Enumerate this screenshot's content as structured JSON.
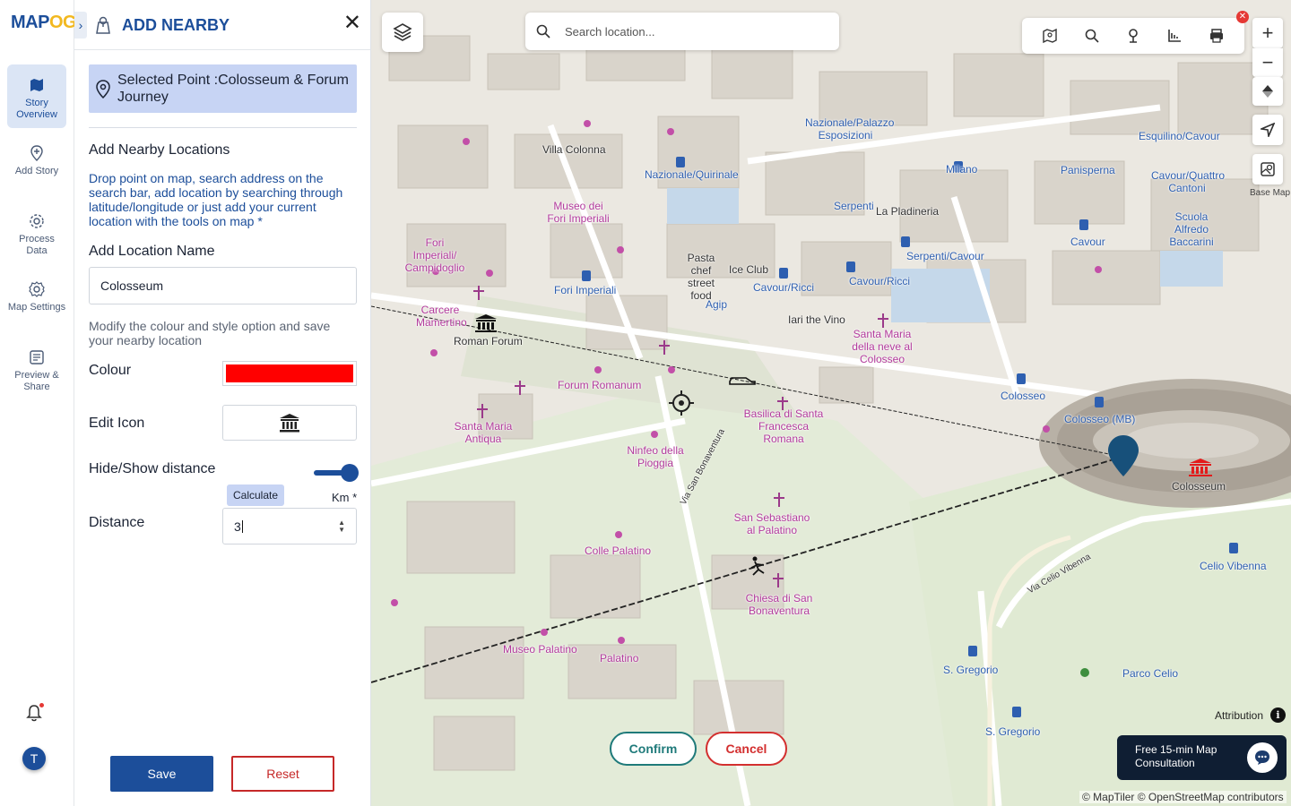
{
  "logo": {
    "text_a": "MAP",
    "text_b": "OG"
  },
  "rail": {
    "items": [
      {
        "label": "Story Overview",
        "icon": "map-icon"
      },
      {
        "label": "Add Story",
        "icon": "pin-plus-icon"
      },
      {
        "label": "Process Data",
        "icon": "gear-icon"
      },
      {
        "label": "Map Settings",
        "icon": "settings-icon"
      },
      {
        "label": "Preview & Share",
        "icon": "preview-icon"
      }
    ],
    "avatar": "T"
  },
  "panel": {
    "title": "ADD NEARBY",
    "selected_point": "Selected Point :Colosseum & Forum Journey",
    "section_title": "Add Nearby Locations",
    "help_text": "Drop point on map, search address on the search bar, add location by searching through latitude/longitude or just add your current location with the tools on map *",
    "location_name_label": "Add Location Name",
    "location_name_value": "Colosseum",
    "modify_text": "Modify the colour and style option and save your nearby location",
    "colour_label": "Colour",
    "colour_value": "#ff0000",
    "edit_icon_label": "Edit Icon",
    "hide_show_label": "Hide/Show distance",
    "calculate_label": "Calculate",
    "unit_label": "Km *",
    "distance_label": "Distance",
    "distance_value": "3",
    "save_label": "Save",
    "reset_label": "Reset"
  },
  "map": {
    "search_placeholder": "Search location...",
    "base_map_label": "Base Map",
    "confirm_label": "Confirm",
    "cancel_label": "Cancel",
    "attribution_label": "Attribution",
    "consult_text": "Free 15-min Map Consultation",
    "copyright": "© MapTiler © OpenStreetMap contributors",
    "labels": [
      {
        "text": "Roman Forum",
        "color": "dark"
      },
      {
        "text": "Forum Romanum",
        "color": "pink"
      },
      {
        "text": "Colosseum",
        "color": "dark"
      },
      {
        "text": "Colosseo",
        "color": "blue"
      },
      {
        "text": "Colosseo (MB)",
        "color": "blue"
      },
      {
        "text": "Basilica di Santa Francesca Romana",
        "color": "pink"
      },
      {
        "text": "Ninfeo della Pioggia",
        "color": "pink"
      },
      {
        "text": "Santa Maria Antiqua",
        "color": "pink"
      },
      {
        "text": "San Sebastiano al Palatino",
        "color": "pink"
      },
      {
        "text": "Colle Palatino",
        "color": "pink"
      },
      {
        "text": "Chiesa di San Bonaventura",
        "color": "pink"
      },
      {
        "text": "Palatino",
        "color": "pink"
      },
      {
        "text": "Museo Palatino",
        "color": "pink"
      },
      {
        "text": "Celio Vibenna",
        "color": "blue"
      },
      {
        "text": "Parco Celio",
        "color": "blue"
      },
      {
        "text": "S. Gregorio",
        "color": "blue"
      },
      {
        "text": "Fori Imperiali/ Campidoglio",
        "color": "pink"
      },
      {
        "text": "Fori Imperiali",
        "color": "blue"
      },
      {
        "text": "Cavour/Ricci",
        "color": "blue"
      },
      {
        "text": "Agip",
        "color": "blue"
      },
      {
        "text": "Ice Club",
        "color": "dark"
      },
      {
        "text": "Pasta chef street food",
        "color": "dark"
      },
      {
        "text": "Iari the Vino",
        "color": "dark"
      },
      {
        "text": "Santa Maria della neve al Colosseo",
        "color": "pink"
      },
      {
        "text": "Serpenti/Cavour",
        "color": "blue"
      },
      {
        "text": "Cavour",
        "color": "blue"
      },
      {
        "text": "Milano",
        "color": "blue"
      },
      {
        "text": "La Pladineria",
        "color": "dark"
      },
      {
        "text": "Serpenti",
        "color": "blue"
      },
      {
        "text": "Nazionale/Quirinale",
        "color": "blue"
      },
      {
        "text": "Villa Colonna",
        "color": "dark"
      },
      {
        "text": "Museo dei Fori Imperiali",
        "color": "pink"
      },
      {
        "text": "Carcere Mamertino",
        "color": "pink"
      },
      {
        "text": "Panisperna",
        "color": "blue"
      },
      {
        "text": "Scuola Alfredo Baccarini",
        "color": "blue"
      },
      {
        "text": "Esquilino/Cavour",
        "color": "blue"
      },
      {
        "text": "Cavour/Quattro Cantoni",
        "color": "blue"
      },
      {
        "text": "Nazionale/Palazzo Esposizioni",
        "color": "blue"
      },
      {
        "text": "Via San Bonaventura",
        "color": "dark"
      },
      {
        "text": "Via Celio Vibenna",
        "color": "dark"
      }
    ]
  }
}
